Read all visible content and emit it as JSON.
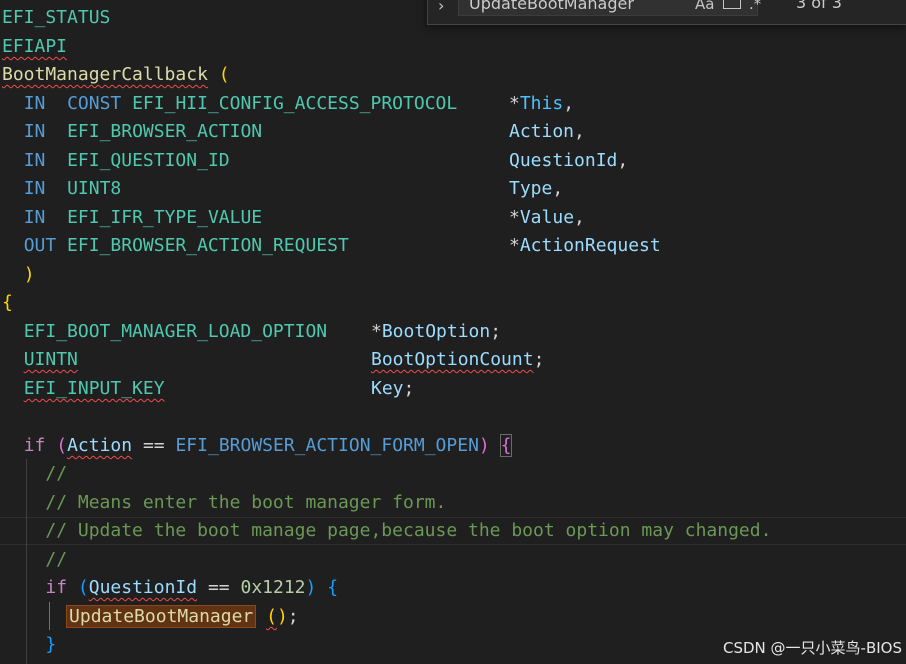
{
  "find_widget": {
    "search_value": "UpdateBootManager",
    "match_case_label": "Aa",
    "regex_label": ".*",
    "match_count": "3 of 3"
  },
  "code": {
    "l1": "EFI_STATUS",
    "l2": "EFIAPI",
    "l3_fn": "BootManagerCallback",
    "p1_dir": "IN",
    "p1_const": "CONST",
    "p1_type": "EFI_HII_CONFIG_ACCESS_PROTOCOL",
    "p1_ptr": "*",
    "p1_name": "This",
    "p2_dir": "IN",
    "p2_type": "EFI_BROWSER_ACTION",
    "p2_name": "Action",
    "p3_dir": "IN",
    "p3_type": "EFI_QUESTION_ID",
    "p3_name": "QuestionId",
    "p4_dir": "IN",
    "p4_type": "UINT8",
    "p4_name": "Type",
    "p5_dir": "IN",
    "p5_type": "EFI_IFR_TYPE_VALUE",
    "p5_ptr": "*",
    "p5_name": "Value",
    "p6_dir": "OUT",
    "p6_type": "EFI_BROWSER_ACTION_REQUEST",
    "p6_ptr": "*",
    "p6_name": "ActionRequest",
    "d1_type": "EFI_BOOT_MANAGER_LOAD_OPTION",
    "d1_ptr": "*",
    "d1_name": "BootOption",
    "d2_type": "UINTN",
    "d2_name": "BootOptionCount",
    "d3_type": "EFI_INPUT_KEY",
    "d3_name": "Key",
    "if1_kw": "if",
    "if1_var": "Action",
    "if1_op": "==",
    "if1_const": "EFI_BROWSER_ACTION_FORM_OPEN",
    "comment1": "//",
    "comment2": "// Means enter the boot manager form.",
    "comment3": "// Update the boot manage page,because the boot option may changed.",
    "comment4": "//",
    "if2_kw": "if",
    "if2_var": "QuestionId",
    "if2_op": "==",
    "if2_num": "0x1212",
    "call_fn": "UpdateBootManager"
  },
  "watermark": "CSDN @一只小菜鸟-BIOS"
}
